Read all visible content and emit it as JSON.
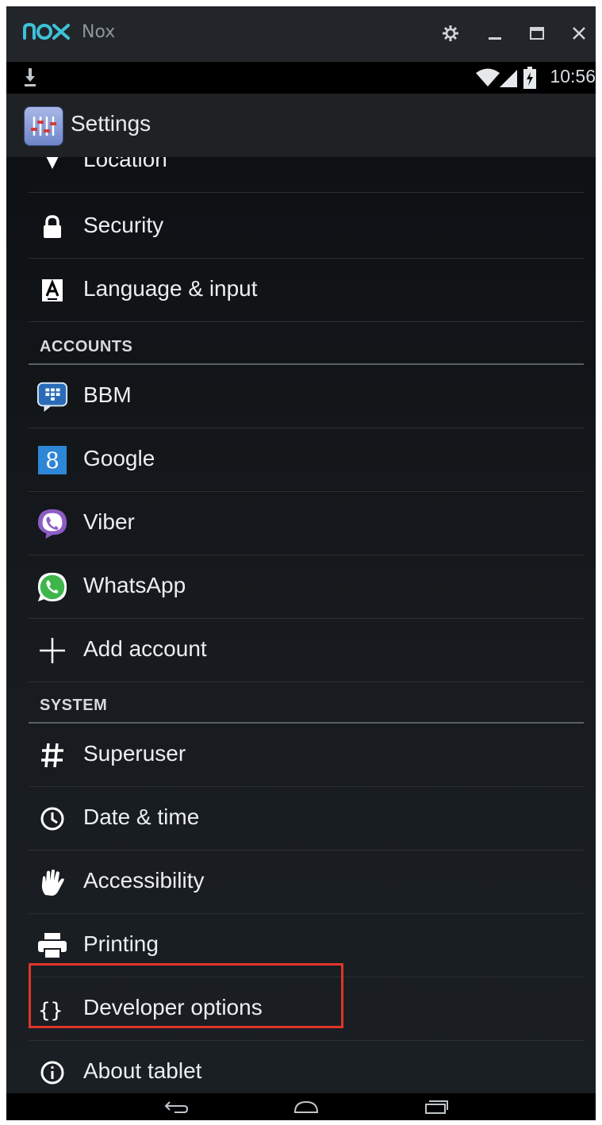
{
  "window": {
    "logo_text": "nox",
    "title": "Nox"
  },
  "window_controls": {
    "settings": "gear-icon",
    "minimize": "minimize-icon",
    "maximize": "maximize-icon",
    "close": "close-icon"
  },
  "status_bar": {
    "time": "10:56",
    "icons": [
      "download-icon",
      "wifi-icon",
      "signal-icon",
      "battery-icon"
    ]
  },
  "action_bar": {
    "title": "Settings",
    "icon": "settings-app-icon"
  },
  "list": {
    "partial_item": {
      "label": "Location",
      "icon": "location-icon"
    },
    "items_top": [
      {
        "label": "Security",
        "icon": "lock-icon"
      },
      {
        "label": "Language & input",
        "icon": "keyboard-a-icon"
      }
    ],
    "accounts_header": "ACCOUNTS",
    "accounts": [
      {
        "label": "BBM",
        "icon": "bbm-icon"
      },
      {
        "label": "Google",
        "icon": "google-icon"
      },
      {
        "label": "Viber",
        "icon": "viber-icon"
      },
      {
        "label": "WhatsApp",
        "icon": "whatsapp-icon"
      },
      {
        "label": "Add account",
        "icon": "plus-icon"
      }
    ],
    "system_header": "SYSTEM",
    "system": [
      {
        "label": "Superuser",
        "icon": "hash-icon"
      },
      {
        "label": "Date & time",
        "icon": "clock-icon"
      },
      {
        "label": "Accessibility",
        "icon": "hand-icon"
      },
      {
        "label": "Printing",
        "icon": "printer-icon"
      },
      {
        "label": "Developer options",
        "icon": "braces-icon",
        "highlighted": true
      },
      {
        "label": "About tablet",
        "icon": "info-icon"
      }
    ]
  },
  "nav_bar": {
    "back": "back-icon",
    "home": "home-icon",
    "recents": "recents-icon"
  },
  "colors": {
    "highlight": "#e0352b",
    "nox_logo": "#3fc1d8",
    "background": "#0c0e10"
  }
}
